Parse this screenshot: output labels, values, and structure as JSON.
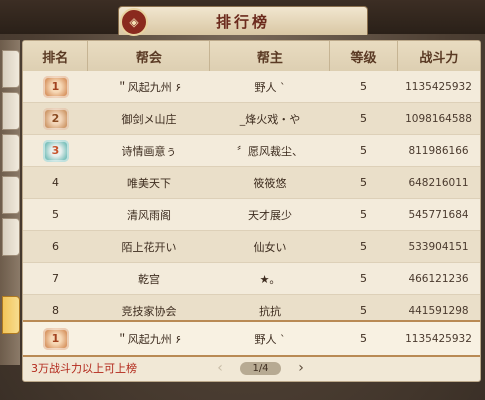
{
  "title": "排行榜",
  "emblem_glyph": "◈",
  "headers": [
    "排名",
    "帮会",
    "帮主",
    "等级",
    "战斗力"
  ],
  "rows": [
    {
      "rank": "1",
      "medal": "gold",
      "guild": "＂风起九州 ۶",
      "leader": "野人 ˋ",
      "level": "5",
      "power": "1135425932"
    },
    {
      "rank": "2",
      "medal": "silver",
      "guild": "御剑メ山庄",
      "leader": "_烽火戏・や",
      "level": "5",
      "power": "1098164588"
    },
    {
      "rank": "3",
      "medal": "bronze",
      "guild": "诗情画意ぅ",
      "leader": "〞愿风裁尘、",
      "level": "5",
      "power": "811986166"
    },
    {
      "rank": "4",
      "medal": "",
      "guild": "唯美天下",
      "leader": "筱筱悠",
      "level": "5",
      "power": "648216011"
    },
    {
      "rank": "5",
      "medal": "",
      "guild": "清风雨阁",
      "leader": "天才展少",
      "level": "5",
      "power": "545771684"
    },
    {
      "rank": "6",
      "medal": "",
      "guild": "陌上花开い",
      "leader": "仙女い",
      "level": "5",
      "power": "533904151"
    },
    {
      "rank": "7",
      "medal": "",
      "guild": "乾宫",
      "leader": "★。",
      "level": "5",
      "power": "466121236"
    },
    {
      "rank": "8",
      "medal": "",
      "guild": "竞技家协会",
      "leader": "抗抗",
      "level": "5",
      "power": "441591298"
    }
  ],
  "self_row": {
    "rank": "1",
    "medal": "gold",
    "guild": "＂风起九州 ۶",
    "leader": "野人 ˋ",
    "level": "5",
    "power": "1135425932"
  },
  "footer_note": "3万战斗力以上可上榜",
  "pager": {
    "label": "1/4",
    "prev": "‹",
    "next": "›"
  },
  "colors": {
    "accent_red": "#b2271a",
    "panel": "#f1e8d6",
    "header_text": "#5a3a24"
  }
}
